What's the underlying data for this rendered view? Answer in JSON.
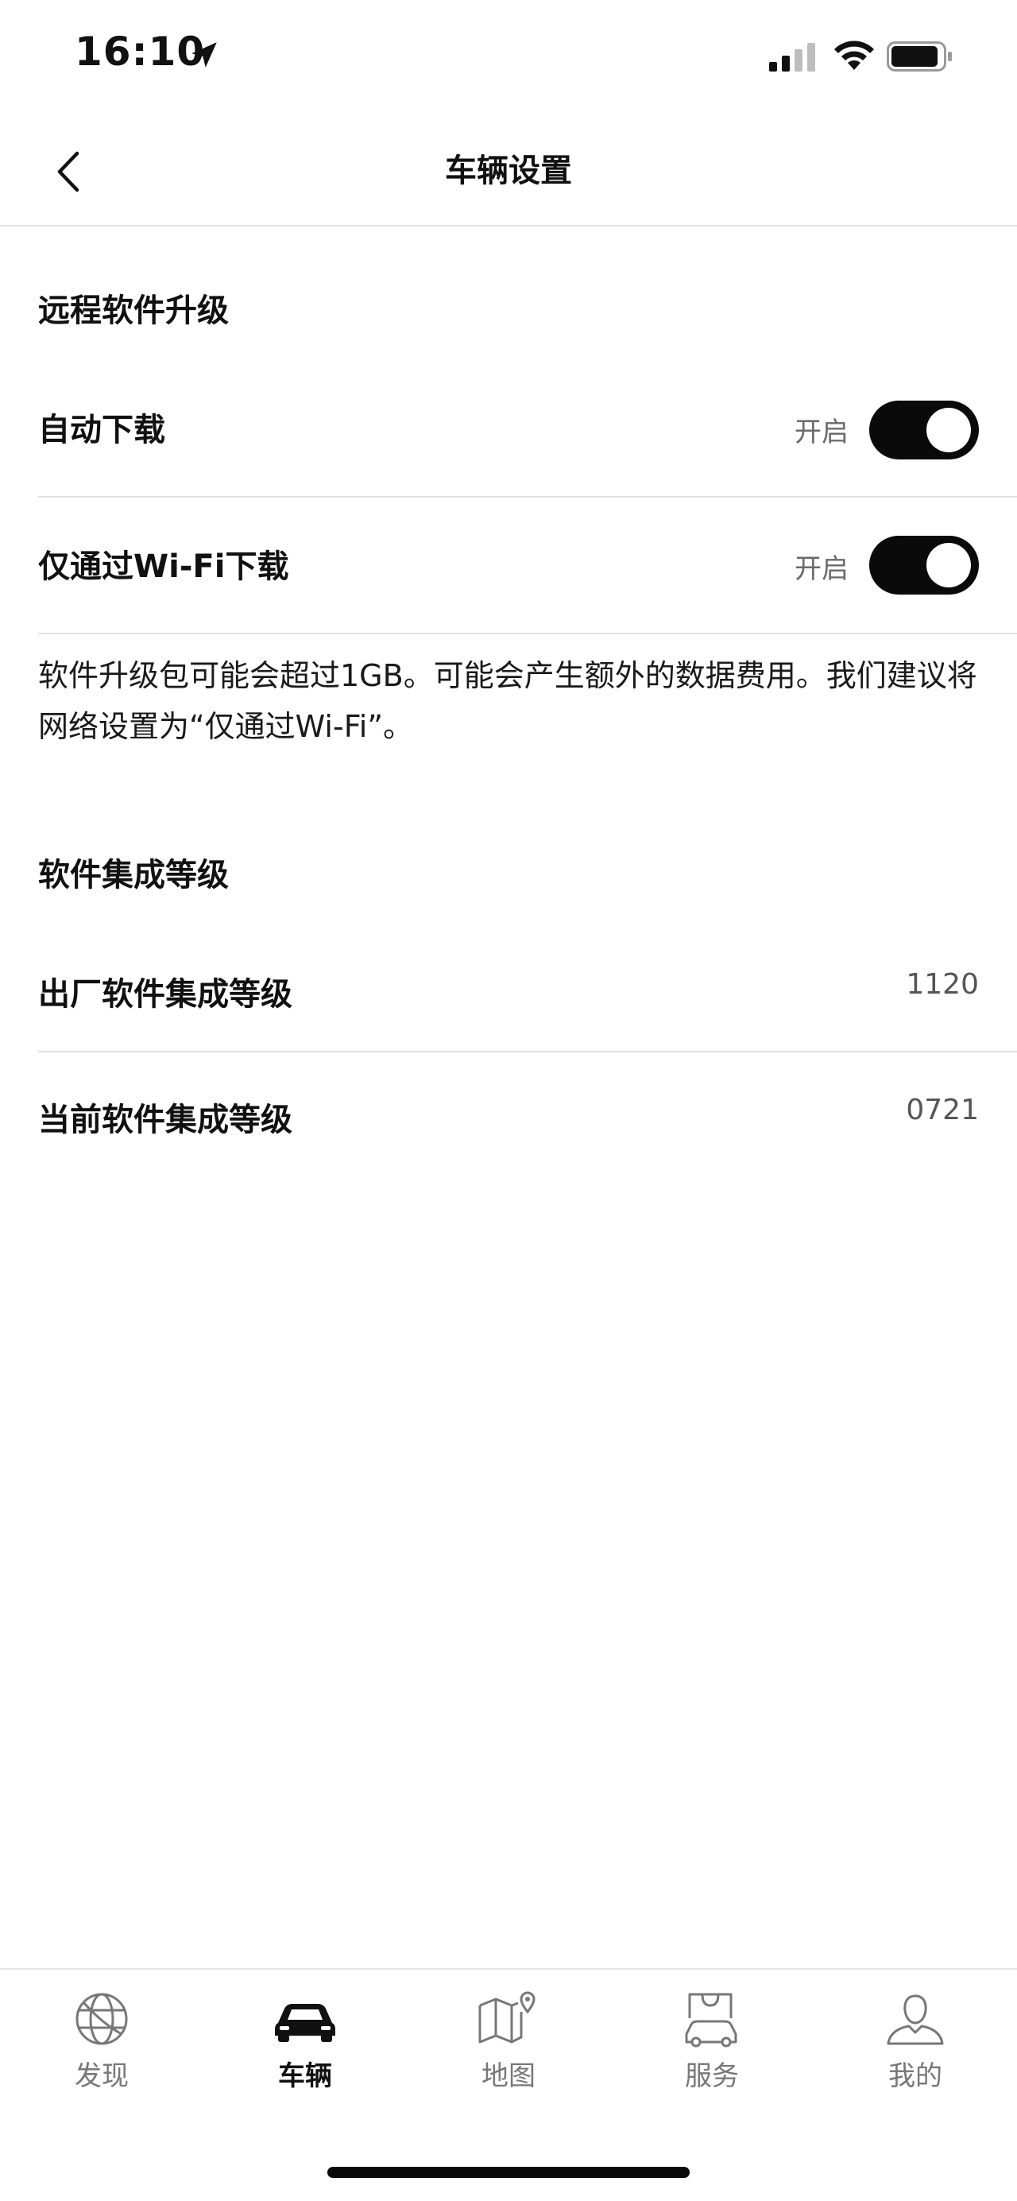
{
  "status_bar": {
    "time": "16:10"
  },
  "header": {
    "title": "车辆设置"
  },
  "sections": {
    "ota": {
      "title": "远程软件升级",
      "auto_download": {
        "label": "自动下载",
        "status": "开启",
        "enabled": true
      },
      "wifi_only": {
        "label": "仅通过Wi-Fi下载",
        "status": "开启",
        "enabled": true
      },
      "note": "软件升级包可能会超过1GB。可能会产生额外的数据费用。我们建议将网络设置为“仅通过Wi-Fi”。"
    },
    "integration": {
      "title": "软件集成等级",
      "factory": {
        "label": "出厂软件集成等级",
        "value": "1120"
      },
      "current": {
        "label": "当前软件集成等级",
        "value": "0721"
      }
    }
  },
  "tabbar": {
    "tabs": [
      {
        "label": "发现",
        "icon": "globe-icon",
        "active": false
      },
      {
        "label": "车辆",
        "icon": "car-icon",
        "active": true
      },
      {
        "label": "地图",
        "icon": "map-icon",
        "active": false
      },
      {
        "label": "服务",
        "icon": "shopping-bag-car-icon",
        "active": false
      },
      {
        "label": "我的",
        "icon": "user-icon",
        "active": false
      }
    ]
  },
  "colors": {
    "toggle_on": "#0a0a0a",
    "divider": "#e2e2e2",
    "muted_text": "#6a6a6a"
  }
}
